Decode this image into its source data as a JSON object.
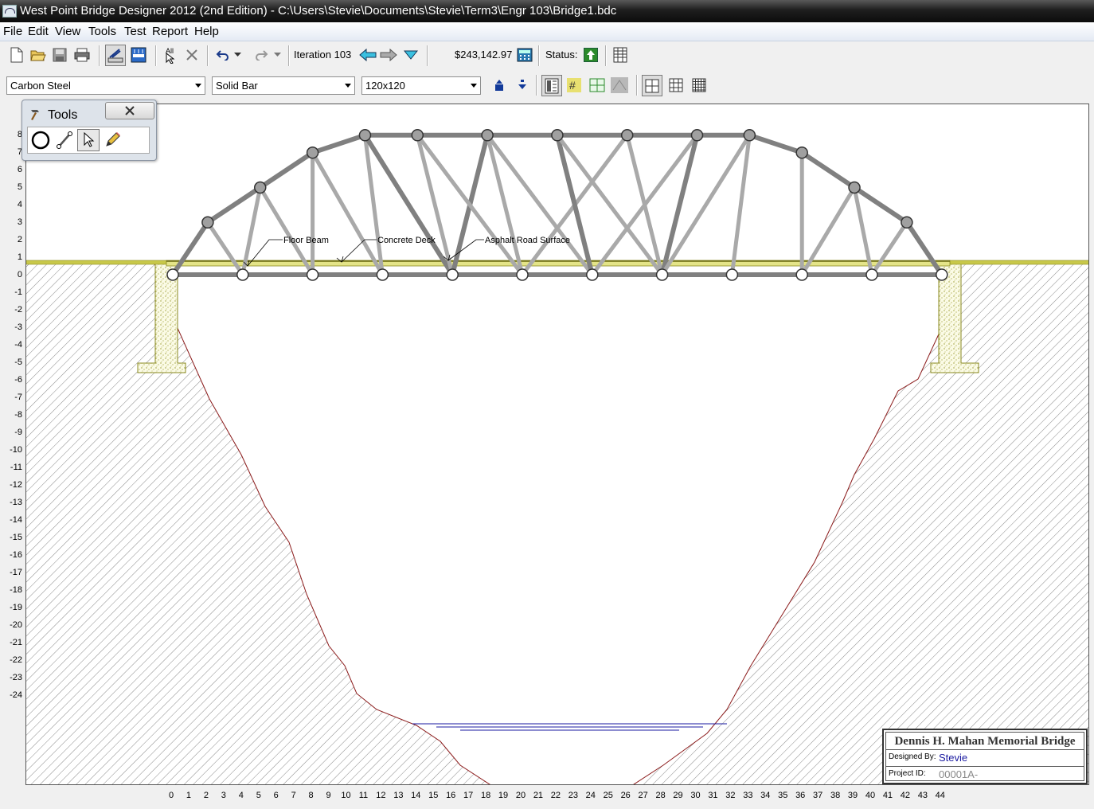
{
  "window": {
    "title": "West Point Bridge Designer 2012 (2nd Edition) - C:\\Users\\Stevie\\Documents\\Stevie\\Term3\\Engr 103\\Bridge1.bdc"
  },
  "menu": [
    "File",
    "Edit",
    "View",
    "Tools",
    "Test",
    "Report",
    "Help"
  ],
  "toolbar": {
    "iteration_label": "Iteration 103",
    "cost": "$243,142.97",
    "status_label": "Status:",
    "status_color": "#2a8a2a"
  },
  "selectors": {
    "material": "Carbon Steel",
    "cross_section": "Solid Bar",
    "size": "120x120"
  },
  "tools_panel": {
    "title": "Tools"
  },
  "annotations": {
    "floor_beam": "Floor Beam",
    "concrete_deck": "Concrete Deck",
    "road_surface": "Asphalt Road Surface"
  },
  "axes": {
    "y_ticks": [
      "8",
      "7",
      "6",
      "5",
      "4",
      "3",
      "2",
      "1",
      "0",
      "-1",
      "-2",
      "-3",
      "-4",
      "-5",
      "-6",
      "-7",
      "-8",
      "-9",
      "-10",
      "-11",
      "-12",
      "-13",
      "-14",
      "-15",
      "-16",
      "-17",
      "-18",
      "-19",
      "-20",
      "-21",
      "-22",
      "-23",
      "-24"
    ],
    "x_ticks": [
      "0",
      "1",
      "2",
      "3",
      "4",
      "5",
      "6",
      "7",
      "8",
      "9",
      "10",
      "11",
      "12",
      "13",
      "14",
      "15",
      "16",
      "17",
      "18",
      "19",
      "20",
      "21",
      "22",
      "23",
      "24",
      "25",
      "26",
      "27",
      "28",
      "29",
      "30",
      "31",
      "32",
      "33",
      "34",
      "35",
      "36",
      "37",
      "38",
      "39",
      "40",
      "41",
      "42",
      "43",
      "44"
    ]
  },
  "title_block": {
    "bridge_name": "Dennis H. Mahan Memorial Bridge",
    "designed_by_label": "Designed By:",
    "designer": "Stevie",
    "designer_color": "#1a1aa0",
    "project_id_label": "Project ID:",
    "project_id": "00001A-"
  },
  "colors": {
    "member": "#a9a9a9",
    "member_heavy": "#808080",
    "joint_top": "#a0a0a0",
    "deck": "#c8c84a",
    "terrain_line": "#8b1a1a",
    "water": "#1a1aa0"
  }
}
